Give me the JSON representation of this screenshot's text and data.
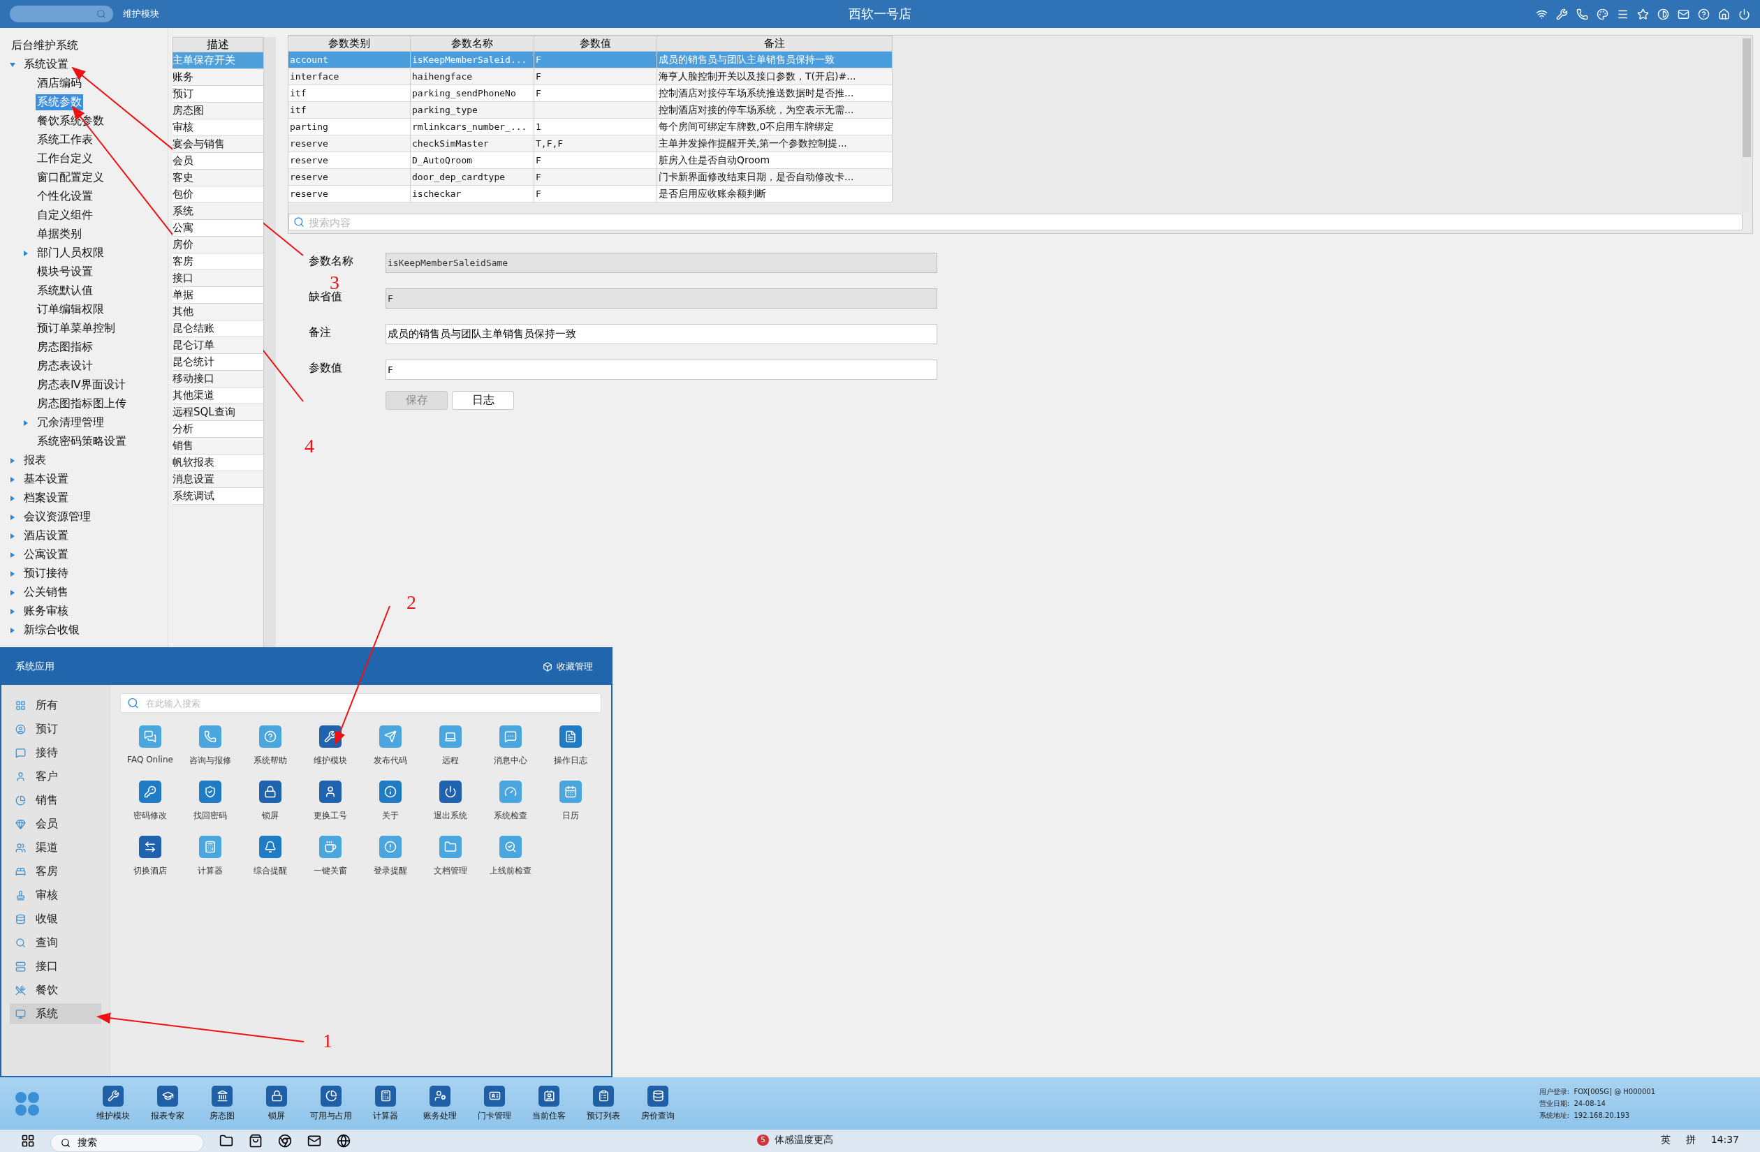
{
  "top_bar": {
    "module": "维护模块",
    "title": "西软一号店"
  },
  "tree": {
    "root": "后台维护系统",
    "items": [
      {
        "label": "系统设置",
        "kind": "folder",
        "expanded": true,
        "selected": false,
        "children": [
          {
            "label": "酒店编码",
            "kind": "leaf",
            "selected": false
          },
          {
            "label": "系统参数",
            "kind": "leaf",
            "selected": true
          },
          {
            "label": "餐饮系统参数",
            "kind": "leaf",
            "selected": false
          },
          {
            "label": "系统工作表",
            "kind": "leaf",
            "selected": false
          },
          {
            "label": "工作台定义",
            "kind": "leaf",
            "selected": false
          },
          {
            "label": "窗口配置定义",
            "kind": "leaf",
            "selected": false
          },
          {
            "label": "个性化设置",
            "kind": "leaf",
            "selected": false
          },
          {
            "label": "自定义组件",
            "kind": "leaf",
            "selected": false
          },
          {
            "label": "单据类别",
            "kind": "leaf",
            "selected": false
          },
          {
            "label": "部门人员权限",
            "kind": "folder",
            "expanded": false,
            "selected": false
          },
          {
            "label": "模块号设置",
            "kind": "leaf",
            "selected": false
          },
          {
            "label": "系统默认值",
            "kind": "leaf",
            "selected": false
          },
          {
            "label": "订单编辑权限",
            "kind": "leaf",
            "selected": false
          },
          {
            "label": "预订单菜单控制",
            "kind": "leaf",
            "selected": false
          },
          {
            "label": "房态图指标",
            "kind": "leaf",
            "selected": false
          },
          {
            "label": "房态表设计",
            "kind": "leaf",
            "selected": false
          },
          {
            "label": "房态表Ⅳ界面设计",
            "kind": "leaf",
            "selected": false
          },
          {
            "label": "房态图指标图上传",
            "kind": "leaf",
            "selected": false
          },
          {
            "label": "冗余清理管理",
            "kind": "folder",
            "expanded": false,
            "selected": false
          },
          {
            "label": "系统密码策略设置",
            "kind": "leaf",
            "selected": false
          }
        ]
      },
      {
        "label": "报表",
        "kind": "folder",
        "expanded": false,
        "selected": false
      },
      {
        "label": "基本设置",
        "kind": "folder",
        "expanded": false,
        "selected": false
      },
      {
        "label": "档案设置",
        "kind": "folder",
        "expanded": false,
        "selected": false
      },
      {
        "label": "会议资源管理",
        "kind": "folder",
        "expanded": false,
        "selected": false
      },
      {
        "label": "酒店设置",
        "kind": "folder",
        "expanded": false,
        "selected": false
      },
      {
        "label": "公寓设置",
        "kind": "folder",
        "expanded": false,
        "selected": false
      },
      {
        "label": "预订接待",
        "kind": "folder",
        "expanded": false,
        "selected": false
      },
      {
        "label": "公关销售",
        "kind": "folder",
        "expanded": false,
        "selected": false
      },
      {
        "label": "账务审核",
        "kind": "folder",
        "expanded": false,
        "selected": false
      },
      {
        "label": "新综合收银",
        "kind": "folder",
        "expanded": false,
        "selected": false
      }
    ]
  },
  "description_list": {
    "header": "描述",
    "items": [
      {
        "label": "主单保存开关",
        "selected": true
      },
      {
        "label": "账务",
        "selected": false
      },
      {
        "label": "预订",
        "selected": false
      },
      {
        "label": "房态图",
        "selected": false
      },
      {
        "label": "审核",
        "selected": false
      },
      {
        "label": "宴会与销售",
        "selected": false
      },
      {
        "label": "会员",
        "selected": false
      },
      {
        "label": "客史",
        "selected": false
      },
      {
        "label": "包价",
        "selected": false
      },
      {
        "label": "系统",
        "selected": false
      },
      {
        "label": "公寓",
        "selected": false
      },
      {
        "label": "房价",
        "selected": false
      },
      {
        "label": "客房",
        "selected": false
      },
      {
        "label": "接口",
        "selected": false
      },
      {
        "label": "单据",
        "selected": false
      },
      {
        "label": "其他",
        "selected": false
      },
      {
        "label": "昆仑结账",
        "selected": false
      },
      {
        "label": "昆仑订单",
        "selected": false
      },
      {
        "label": "昆仑统计",
        "selected": false
      },
      {
        "label": "移动接口",
        "selected": false
      },
      {
        "label": "其他渠道",
        "selected": false
      },
      {
        "label": "远程SQL查询",
        "selected": false
      },
      {
        "label": "分析",
        "selected": false
      },
      {
        "label": "销售",
        "selected": false
      },
      {
        "label": "帆软报表",
        "selected": false
      },
      {
        "label": "消息设置",
        "selected": false
      },
      {
        "label": "系统调试",
        "selected": false
      }
    ]
  },
  "table": {
    "columns": [
      "参数类别",
      "参数名称",
      "参数值",
      "备注"
    ],
    "rows": [
      {
        "cells": [
          "account",
          "isKeepMemberSaleid...",
          "F",
          "成员的销售员与团队主单销售员保持一致"
        ],
        "selected": true
      },
      {
        "cells": [
          "interface",
          "haihengface",
          "F",
          "海亨人脸控制开关以及接口参数，T(开启)#..."
        ],
        "selected": false
      },
      {
        "cells": [
          "itf",
          "parking_sendPhoneNo",
          "F",
          "控制酒店对接停车场系统推送数据时是否推..."
        ],
        "selected": false
      },
      {
        "cells": [
          "itf",
          "parking_type",
          "",
          "控制酒店对接的停车场系统，为空表示无需..."
        ],
        "selected": false
      },
      {
        "cells": [
          "parting",
          "rmlinkcars_number_...",
          "1",
          "每个房间可绑定车牌数,0不启用车牌绑定"
        ],
        "selected": false
      },
      {
        "cells": [
          "reserve",
          "checkSimMaster",
          "T,F,F",
          "主单并发操作提醒开关,第一个参数控制提..."
        ],
        "selected": false
      },
      {
        "cells": [
          "reserve",
          "D_AutoQroom",
          "F",
          "脏房入住是否自动Qroom"
        ],
        "selected": false
      },
      {
        "cells": [
          "reserve",
          "door_dep_cardtype",
          "F",
          "门卡新界面修改结束日期，是否自动修改卡..."
        ],
        "selected": false
      },
      {
        "cells": [
          "reserve",
          "ischeckar",
          "F",
          "是否启用应收账余额判断"
        ],
        "selected": false
      }
    ],
    "search_placeholder": "搜索内容"
  },
  "form": {
    "fields": [
      {
        "label": "参数名称",
        "value": "isKeepMemberSaleidSame",
        "readonly": true
      },
      {
        "label": "缺省值",
        "value": "F",
        "readonly": true
      },
      {
        "label": "备注",
        "value": "成员的销售员与团队主单销售员保持一致",
        "readonly": false
      },
      {
        "label": "参数值",
        "value": "F",
        "readonly": false
      }
    ],
    "buttons": [
      {
        "label": "保存",
        "disabled": true
      },
      {
        "label": "日志",
        "disabled": false
      }
    ]
  },
  "app_popup": {
    "title": "系统应用",
    "favorites": "收藏管理",
    "search_placeholder": "在此输入搜索",
    "categories": [
      {
        "label": "所有",
        "selected": false
      },
      {
        "label": "预订",
        "selected": false
      },
      {
        "label": "接待",
        "selected": false
      },
      {
        "label": "客户",
        "selected": false
      },
      {
        "label": "销售",
        "selected": false
      },
      {
        "label": "会员",
        "selected": false
      },
      {
        "label": "渠道",
        "selected": false
      },
      {
        "label": "客房",
        "selected": false
      },
      {
        "label": "审核",
        "selected": false
      },
      {
        "label": "收银",
        "selected": false
      },
      {
        "label": "查询",
        "selected": false
      },
      {
        "label": "接口",
        "selected": false
      },
      {
        "label": "餐饮",
        "selected": false
      },
      {
        "label": "系统",
        "selected": true
      }
    ],
    "apps": [
      {
        "label": "FAQ Online",
        "color": "#4aa6de"
      },
      {
        "label": "咨询与报修",
        "color": "#4aa6de"
      },
      {
        "label": "系统帮助",
        "color": "#4aa6de"
      },
      {
        "label": "维护模块",
        "color": "#1f62ad"
      },
      {
        "label": "发布代码",
        "color": "#4aa6de"
      },
      {
        "label": "远程",
        "color": "#4aa6de"
      },
      {
        "label": "消息中心",
        "color": "#4aa6de"
      },
      {
        "label": "操作日志",
        "color": "#1f7cc4"
      },
      {
        "label": "密码修改",
        "color": "#1f7cc4"
      },
      {
        "label": "找回密码",
        "color": "#1f7cc4"
      },
      {
        "label": "锁屏",
        "color": "#1f62ad"
      },
      {
        "label": "更换工号",
        "color": "#1f62ad"
      },
      {
        "label": "关于",
        "color": "#1f7cc4"
      },
      {
        "label": "退出系统",
        "color": "#1f62ad"
      },
      {
        "label": "系统检查",
        "color": "#4aa6de"
      },
      {
        "label": "日历",
        "color": "#4aa6de"
      },
      {
        "label": "切换酒店",
        "color": "#1f62ad"
      },
      {
        "label": "计算器",
        "color": "#4aa6de"
      },
      {
        "label": "综合提醒",
        "color": "#1f7cc4"
      },
      {
        "label": "一键关窗",
        "color": "#4aa6de"
      },
      {
        "label": "登录提醒",
        "color": "#4aa6de"
      },
      {
        "label": "文档管理",
        "color": "#4aa6de"
      },
      {
        "label": "上线前检查",
        "color": "#4aa6de"
      }
    ]
  },
  "app_bar": {
    "items": [
      {
        "label": "维护模块"
      },
      {
        "label": "报表专家"
      },
      {
        "label": "房态图"
      },
      {
        "label": "锁屏"
      },
      {
        "label": "可用与占用"
      },
      {
        "label": "计算器"
      },
      {
        "label": "账务处理"
      },
      {
        "label": "门卡管理"
      },
      {
        "label": "当前住客"
      },
      {
        "label": "预订列表"
      },
      {
        "label": "房价查询"
      }
    ],
    "info": [
      "用户登录:  FOX[005G] @ H000001",
      "营业日期:  24-08-14",
      "系统地址:  192.168.20.193"
    ]
  },
  "taskbar": {
    "search": "搜索",
    "weather_badge": "5",
    "weather": "体感温度更高",
    "tray": [
      "英",
      "拼"
    ],
    "time": "14:37"
  },
  "annotations": [
    {
      "label": "1"
    },
    {
      "label": "2"
    },
    {
      "label": "3"
    },
    {
      "label": "4"
    }
  ]
}
